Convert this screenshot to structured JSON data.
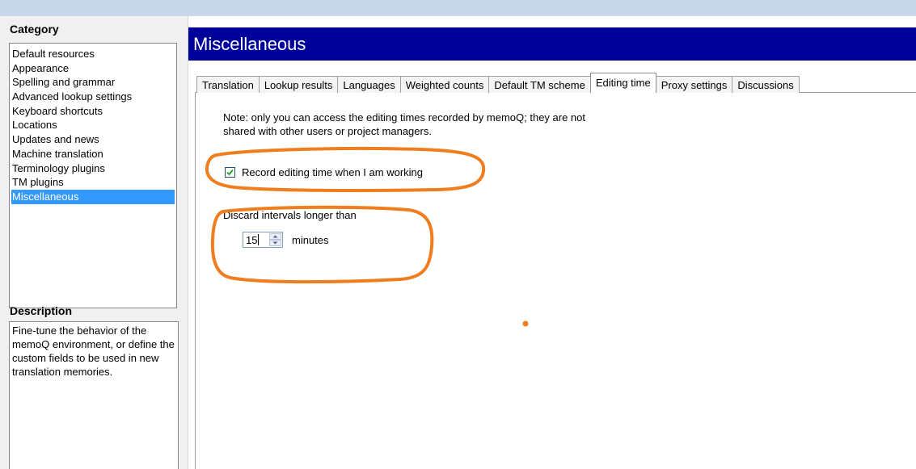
{
  "sidebar": {
    "category_heading": "Category",
    "categories": [
      "Default resources",
      "Appearance",
      "Spelling and grammar",
      "Advanced lookup settings",
      "Keyboard shortcuts",
      "Locations",
      "Updates and news",
      "Machine translation",
      "Terminology plugins",
      "TM plugins",
      "Miscellaneous"
    ],
    "selected_category": "Miscellaneous",
    "description_heading": "Description",
    "description_text": "Fine-tune the behavior of the memoQ environment, or define the custom fields to be used in new translation memories."
  },
  "page": {
    "title": "Miscellaneous"
  },
  "tabs": [
    "Translation",
    "Lookup results",
    "Languages",
    "Weighted counts",
    "Default TM scheme",
    "Editing time",
    "Proxy settings",
    "Discussions"
  ],
  "active_tab": "Editing time",
  "editing_time": {
    "note_line1": "Note: only you can access the editing times recorded by memoQ; they are not",
    "note_line2": "shared with other users or project managers.",
    "record_label": "Record editing time when I am working",
    "record_checked": true,
    "discard_label": "Discard intervals longer than",
    "discard_value": "15",
    "minutes_label": "minutes"
  },
  "colors": {
    "header_bg": "#00009a",
    "selection_bg": "#3399ff",
    "annotation": "#f07d1e"
  }
}
